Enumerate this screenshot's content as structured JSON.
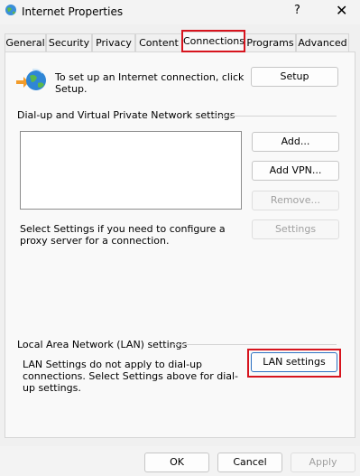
{
  "window": {
    "title": "Internet Properties",
    "help_glyph": "?",
    "close_glyph": "✕"
  },
  "tabs": [
    {
      "label": "General"
    },
    {
      "label": "Security"
    },
    {
      "label": "Privacy"
    },
    {
      "label": "Content"
    },
    {
      "label": "Connections",
      "active": true
    },
    {
      "label": "Programs"
    },
    {
      "label": "Advanced"
    }
  ],
  "connections": {
    "setup_text": "To set up an Internet connection, click Setup.",
    "setup_button": "Setup",
    "dialup_group_label": "Dial-up and Virtual Private Network settings",
    "add_button": "Add...",
    "add_vpn_button": "Add VPN...",
    "remove_button": "Remove...",
    "settings_button": "Settings",
    "proxy_text": "Select Settings if you need to configure a proxy server for a connection.",
    "lan_group_label": "Local Area Network (LAN) settings",
    "lan_text": "LAN Settings do not apply to dial-up connections. Select Settings above for dial-up settings.",
    "lan_settings_button": "LAN settings"
  },
  "footer": {
    "ok_button": "OK",
    "cancel_button": "Cancel",
    "apply_button": "Apply"
  },
  "colors": {
    "highlight": "#d7141e",
    "accent": "#2e72c2"
  },
  "icons": {
    "app": "internet-globe-icon",
    "setup": "network-globe-icon"
  }
}
